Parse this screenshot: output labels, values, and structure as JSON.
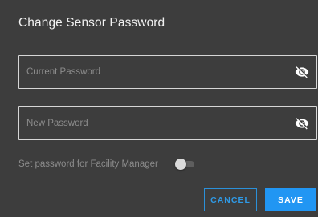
{
  "dialog": {
    "title": "Change Sensor Password"
  },
  "current_password": {
    "value": "",
    "placeholder": "Current Password",
    "visibility_icon": "eye-off-icon"
  },
  "new_password": {
    "value": "",
    "placeholder": "New Password",
    "visibility_icon": "eye-off-icon"
  },
  "facility_manager": {
    "label": "Set password for Facility Manager",
    "enabled": false
  },
  "actions": {
    "cancel_label": "CANCEL",
    "save_label": "SAVE"
  },
  "colors": {
    "background": "#3d3d3d",
    "accent": "#2196f3",
    "text": "#f2f2f2",
    "muted_text": "#8c8c8c"
  }
}
